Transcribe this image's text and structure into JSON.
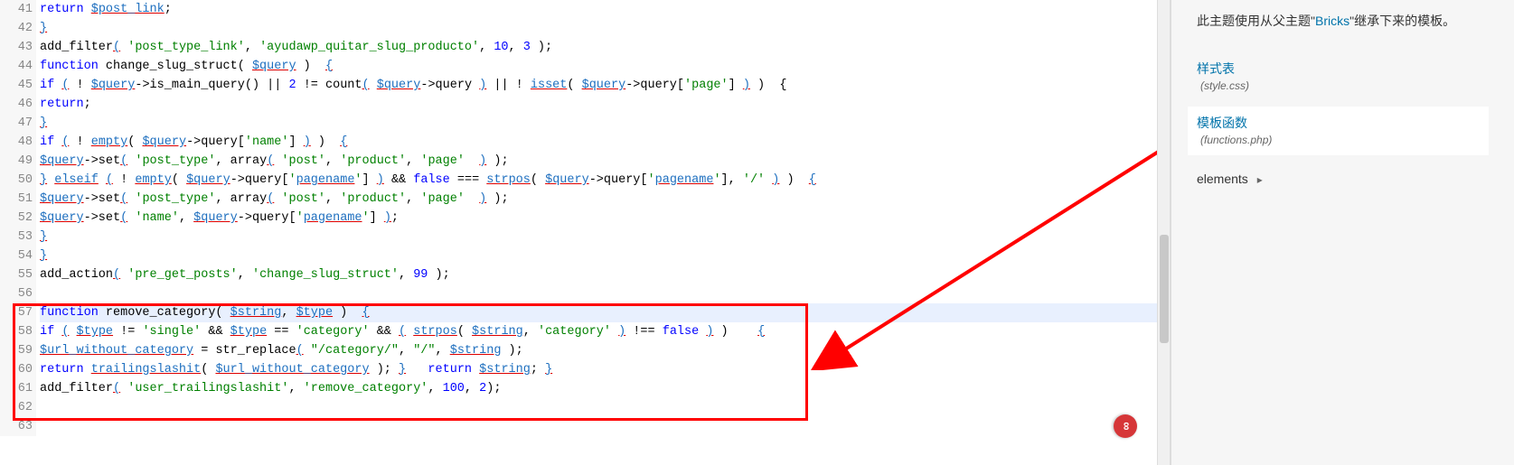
{
  "first_line_number": 41,
  "lines": [
    {
      "n": 41,
      "html": "<span class='k-blue'>return</span> <span class='var'>$post_link</span>;"
    },
    {
      "n": 42,
      "html": "<span class='pun'>}</span>"
    },
    {
      "n": 43,
      "html": "add_filter<span class='pun'>(</span> <span class='str'>'post_type_link'</span>, <span class='str'>'ayudawp_quitar_slug_producto'</span>, <span class='num'>10</span>, <span class='num'>3</span> );"
    },
    {
      "n": 44,
      "html": "<span class='k-blue'>function</span> change_slug_struct( <span class='var'>$query</span> )  <span class='pun'>{</span>"
    },
    {
      "n": 45,
      "html": "<span class='k-blue'>if</span> <span class='pun'>(</span> ! <span class='var'>$query</span>->is_main_query() || <span class='num'>2</span> != count<span class='pun'>(</span> <span class='var'>$query</span>->query <span class='pun'>)</span> || ! <span class='fn'>isset</span>( <span class='var'>$query</span>->query[<span class='str'>'page'</span>] <span class='pun'>)</span> )  {"
    },
    {
      "n": 46,
      "html": "<span class='k-blue'>return</span>;"
    },
    {
      "n": 47,
      "html": "<span class='pun'>}</span>"
    },
    {
      "n": 48,
      "html": "<span class='k-blue'>if</span> <span class='pun'>(</span> ! <span class='fn'>empty</span>( <span class='var'>$query</span>->query[<span class='str'>'name'</span>] <span class='pun'>)</span> )  <span class='pun'>{</span>"
    },
    {
      "n": 49,
      "html": "<span class='var'>$query</span>->set<span class='pun'>(</span> <span class='str'>'post_type'</span>, array<span class='pun'>(</span> <span class='str'>'post'</span>, <span class='str'>'product'</span>, <span class='str'>'page'</span>  <span class='pun'>)</span> );"
    },
    {
      "n": 50,
      "html": "<span class='pun'>}</span> <span class='fn'>elseif</span> <span class='pun'>(</span> ! <span class='fn'>empty</span>( <span class='var'>$query</span>->query[<span class='str'>'<span class=fn>pagename</span>'</span>] <span class='pun'>)</span> && <span class='k-blue'>false</span> === <span class='fn'>strpos</span>( <span class='var'>$query</span>->query[<span class='str'>'<span class=fn>pagename</span>'</span>], <span class='str'>'/'</span> <span class='pun'>)</span> )  <span class='pun'>{</span>"
    },
    {
      "n": 51,
      "html": "<span class='var'>$query</span>->set<span class='pun'>(</span> <span class='str'>'post_type'</span>, array<span class='pun'>(</span> <span class='str'>'post'</span>, <span class='str'>'product'</span>, <span class='str'>'page'</span>  <span class='pun'>)</span> );"
    },
    {
      "n": 52,
      "html": "<span class='var'>$query</span>->set<span class='pun'>(</span> <span class='str'>'name'</span>, <span class='var'>$query</span>->query[<span class='str'>'<span class=fn>pagename</span>'</span>] <span class='pun'>)</span>;"
    },
    {
      "n": 53,
      "html": "<span class='pun'>}</span>"
    },
    {
      "n": 54,
      "html": "<span class='pun'>}</span>"
    },
    {
      "n": 55,
      "html": "add_action<span class='pun'>(</span> <span class='str'>'pre_get_posts'</span>, <span class='str'>'change_slug_struct'</span>, <span class='num'>99</span> );"
    },
    {
      "n": 56,
      "html": ""
    },
    {
      "n": 57,
      "html": "<span class='k-blue'>function</span> remove_category( <span class='var'>$string</span>, <span class='var'>$type</span> )  <span class='pun'>{</span>",
      "cur": true
    },
    {
      "n": 58,
      "html": "<span class='k-blue'>if</span> <span class='pun'>(</span> <span class='var'>$type</span> != <span class='str'>'single'</span> && <span class='var'>$type</span> == <span class='str'>'category'</span> && <span class='pun'>(</span> <span class='fn'>strpos</span>( <span class='var'>$string</span>, <span class='str'>'category'</span> <span class='pun'>)</span> !== <span class='k-blue'>false</span> <span class='pun'>)</span> )    <span class='pun'>{</span>"
    },
    {
      "n": 59,
      "html": "<span class='var'>$url_without_category</span> = str_replace<span class='pun'>(</span> <span class='str'>\"/category/\"</span>, <span class='str'>\"/\"</span>, <span class='var'>$string</span> );"
    },
    {
      "n": 60,
      "html": "<span class='k-blue'>return</span> <span class='fn'>trailingslashit</span>( <span class='var'>$url_without_category</span> ); <span class='pun'>}</span>   <span class='k-blue'>return</span> <span class='var'>$string</span>; <span class='pun'>}</span>"
    },
    {
      "n": 61,
      "html": "add_filter<span class='pun'>(</span> <span class='str'>'user_trailingslashit'</span>, <span class='str'>'remove_category'</span>, <span class='num'>100</span>, <span class='num'>2</span>);"
    },
    {
      "n": 62,
      "html": ""
    },
    {
      "n": 63,
      "html": ""
    }
  ],
  "sidebar": {
    "desc_prefix": "此主题使用从父主题\"",
    "desc_link": "Bricks",
    "desc_suffix": "\"继承下来的模板。",
    "style_title": "样式表",
    "style_meta": "(style.css)",
    "func_title": "模板函数",
    "func_meta": "(functions.php)",
    "elements_label": "elements",
    "chevron": "▸"
  },
  "infinity_icon": "∞"
}
